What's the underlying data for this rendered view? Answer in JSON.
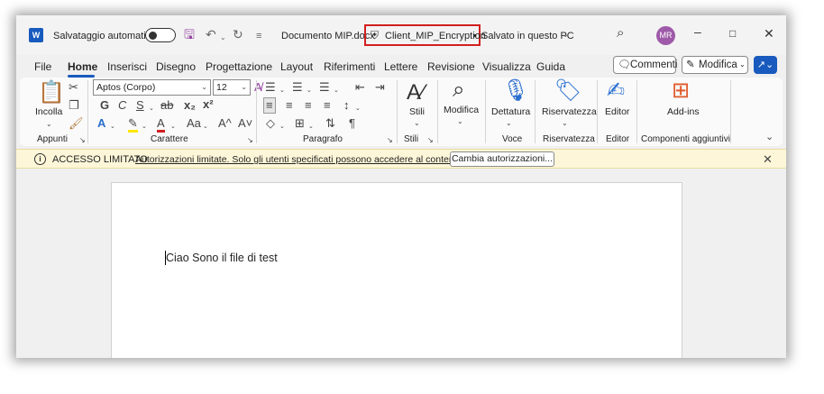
{
  "titlebar": {
    "autosave_label": "Salvataggio automatico",
    "doc_name": "Documento MIP.docx",
    "sensitivity_label": "Client_MIP_Encryption",
    "bullet": "•",
    "save_status": "Salvato in questo PC",
    "avatar_initials": "MR",
    "word_logo": "W"
  },
  "menu": {
    "items": [
      "File",
      "Home",
      "Inserisci",
      "Disegno",
      "Progettazione",
      "Layout",
      "Riferimenti",
      "Lettere",
      "Revisione",
      "Visualizza",
      "Guida"
    ],
    "active": "Home",
    "comments_label": "Commenti",
    "edit_label": "Modifica"
  },
  "ribbon": {
    "paste_label": "Incolla",
    "font_name": "Aptos (Corpo)",
    "font_size": "12",
    "bold": "G",
    "italic": "C",
    "underline": "S",
    "strike": "ab",
    "subscript": "x₂",
    "superscript": "x²",
    "text_effects": "A",
    "font_color": "A",
    "change_case": "Aa",
    "grow_font": "A^",
    "shrink_font": "A˅",
    "styles_label": "Stili",
    "edit_label": "Modifica",
    "dictate_label": "Dettatura",
    "sensitivity_label": "Riservatezza",
    "editor_label": "Editor",
    "addins_label": "Add-ins",
    "groups": {
      "clipboard": "Appunti",
      "font": "Carattere",
      "paragraph": "Paragrafo",
      "styles": "Stili",
      "voice": "Voce",
      "sensitivity": "Riservatezza",
      "editor": "Editor",
      "addins": "Componenti aggiuntivi"
    }
  },
  "infobar": {
    "title": "ACCESSO LIMITATO",
    "message": "Autorizzazioni limitate. Solo gli utenti specificati possono accedere al contenuto.",
    "button": "Cambia autorizzazioni..."
  },
  "document": {
    "text": "Ciao Sono il file di test"
  },
  "colors": {
    "accent": "#185abd",
    "highlight_box": "#d21f1f",
    "infobar_bg": "#fdf6d8",
    "avatar_bg": "#9e5aa8"
  }
}
